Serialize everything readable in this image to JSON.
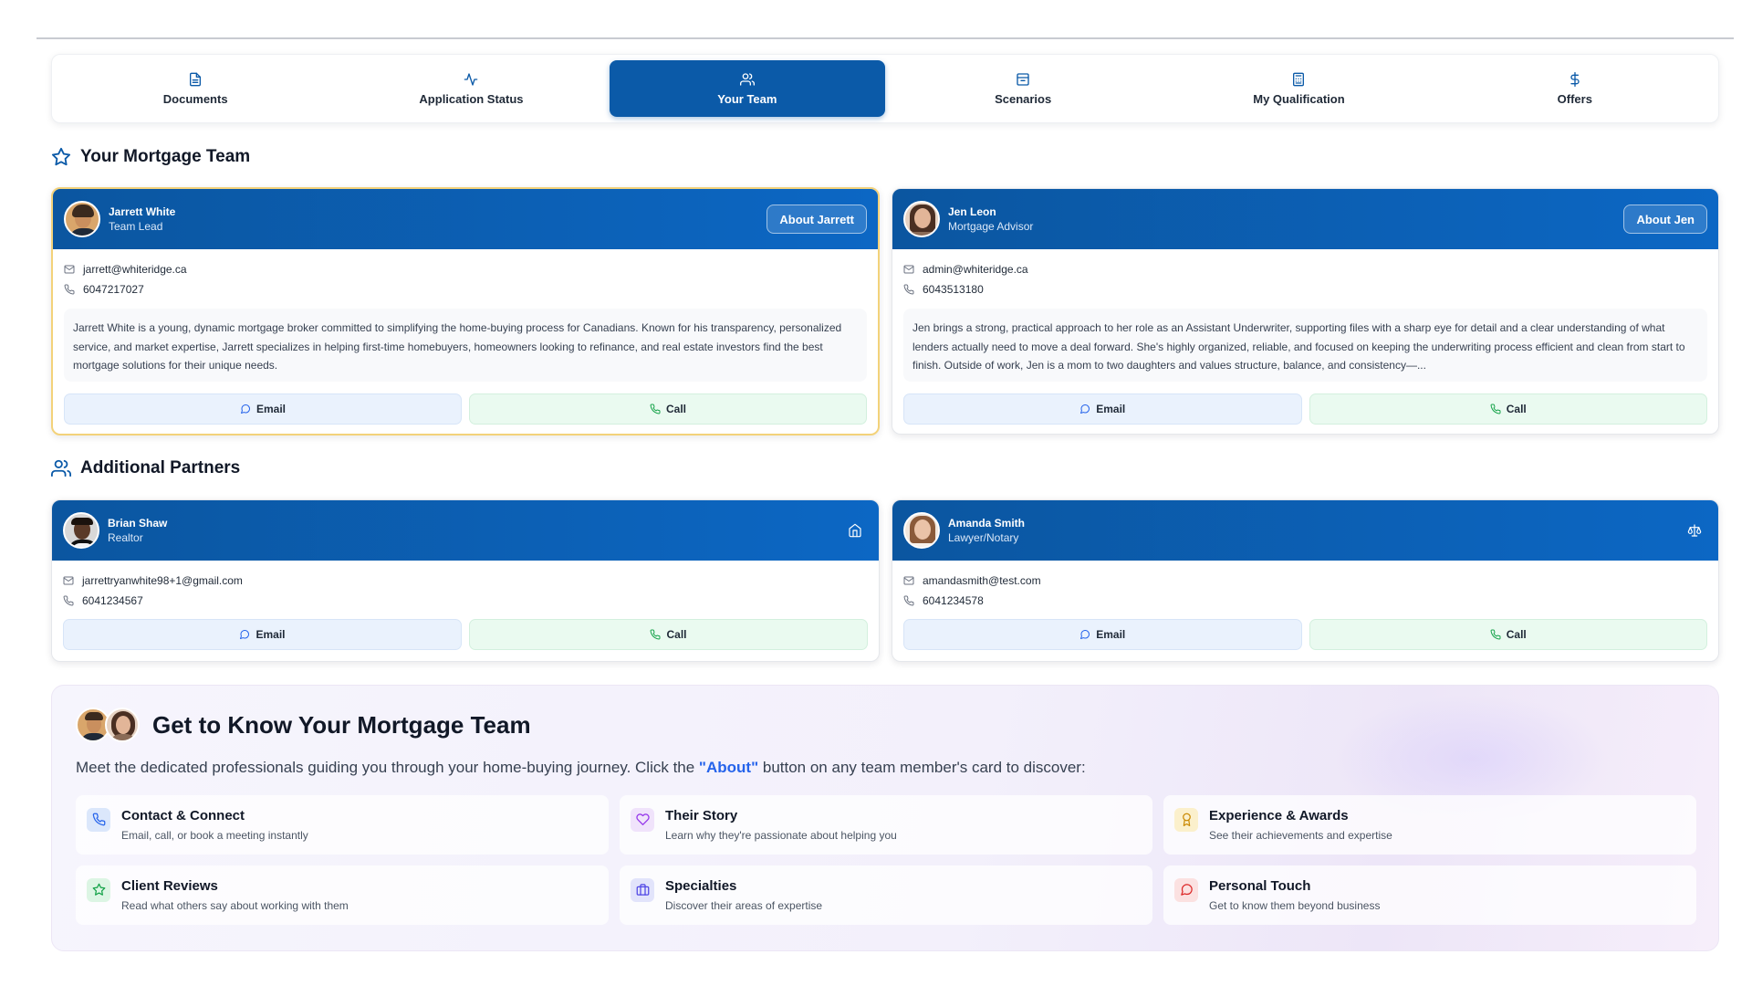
{
  "tabs": [
    {
      "label": "Documents",
      "icon": "document-icon"
    },
    {
      "label": "Application Status",
      "icon": "activity-icon"
    },
    {
      "label": "Your Team",
      "icon": "users-icon",
      "active": true
    },
    {
      "label": "Scenarios",
      "icon": "archive-icon"
    },
    {
      "label": "My Qualification",
      "icon": "calculator-icon"
    },
    {
      "label": "Offers",
      "icon": "dollar-icon"
    }
  ],
  "team_section": {
    "title": "Your Mortgage Team"
  },
  "partners_section": {
    "title": "Additional Partners"
  },
  "team": [
    {
      "name": "Jarrett White",
      "role": "Team Lead",
      "about_label": "About Jarrett",
      "email": "jarrett@whiteridge.ca",
      "phone": "6047217027",
      "bio": "Jarrett White is a young, dynamic mortgage broker committed to simplifying the home-buying process for Canadians. Known for his transparency, personalized service, and market expertise, Jarrett specializes in helping first-time homebuyers, homeowners looking to refinance, and real estate investors find the best mortgage solutions for their unique needs.",
      "email_label": "Email",
      "call_label": "Call"
    },
    {
      "name": "Jen Leon",
      "role": "Mortgage Advisor",
      "about_label": "About Jen",
      "email": "admin@whiteridge.ca",
      "phone": "6043513180",
      "bio": "Jen brings a strong, practical approach to her role as an Assistant Underwriter, supporting files with a sharp eye for detail and a clear understanding of what lenders actually need to move a deal forward. She's highly organized, reliable, and focused on keeping the underwriting process efficient and clean from start to finish. Outside of work, Jen is a mom to two daughters and values structure, balance, and consistency—...",
      "email_label": "Email",
      "call_label": "Call"
    }
  ],
  "partners": [
    {
      "name": "Brian Shaw",
      "role": "Realtor",
      "icon": "home-icon",
      "email": "jarrettryanwhite98+1@gmail.com",
      "phone": "6041234567",
      "email_label": "Email",
      "call_label": "Call"
    },
    {
      "name": "Amanda Smith",
      "role": "Lawyer/Notary",
      "icon": "scale-icon",
      "email": "amandasmith@test.com",
      "phone": "6041234578",
      "email_label": "Email",
      "call_label": "Call"
    }
  ],
  "know": {
    "title": "Get to Know Your Mortgage Team",
    "subtitle_pre": "Meet the dedicated professionals guiding you through your home-buying journey. Click the ",
    "subtitle_hl": "\"About\"",
    "subtitle_post": " button on any team member's card to discover:",
    "features": [
      {
        "title": "Contact & Connect",
        "desc": "Email, call, or book a meeting instantly",
        "icon": "phone-icon",
        "color": "#2563eb",
        "bg": "#dbe7fb"
      },
      {
        "title": "Their Story",
        "desc": "Learn why they're passionate about helping you",
        "icon": "heart-icon",
        "color": "#9333ea",
        "bg": "#f0e3fb"
      },
      {
        "title": "Experience & Awards",
        "desc": "See their achievements and expertise",
        "icon": "award-icon",
        "color": "#ca8a04",
        "bg": "#fbf0cc"
      },
      {
        "title": "Client Reviews",
        "desc": "Read what others say about working with them",
        "icon": "star-icon",
        "color": "#16a34a",
        "bg": "#dcf5e4"
      },
      {
        "title": "Specialties",
        "desc": "Discover their areas of expertise",
        "icon": "briefcase-icon",
        "color": "#4f46e5",
        "bg": "#e2e4fb"
      },
      {
        "title": "Personal Touch",
        "desc": "Get to know them beyond business",
        "icon": "message-icon",
        "color": "#dc2626",
        "bg": "#fbe1e1"
      }
    ]
  }
}
